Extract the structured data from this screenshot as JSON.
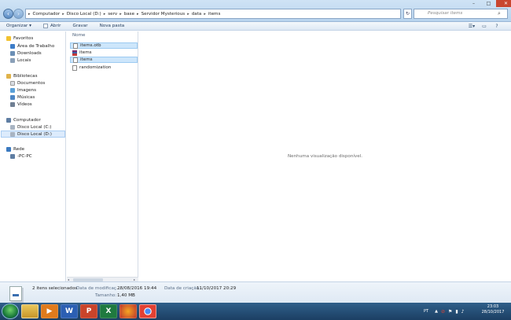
{
  "address": {
    "segments": [
      "Computador",
      "Disco Local (D:)",
      "serv",
      "base",
      "Servidor Mysterious",
      "data",
      "items"
    ]
  },
  "search": {
    "placeholder": "Pesquisar items"
  },
  "window_buttons": {
    "minimize": "–",
    "maximize": "□",
    "close": "✕"
  },
  "toolbar": {
    "organize": "Organizar",
    "open": "Abrir",
    "save": "Gravar",
    "new_folder": "Nova pasta"
  },
  "nav": {
    "favorites": "Favoritos",
    "desktop": "Área de Trabalho",
    "downloads": "Downloads",
    "places": "Locais",
    "libraries": "Bibliotecas",
    "documents": "Documentos",
    "images": "Imagens",
    "music": "Músicas",
    "videos": "Vídeos",
    "computer": "Computador",
    "disk_c": "Disco Local (C:)",
    "disk_d": "Disco Local (D:)",
    "network": "Rede",
    "pc": "-PC-PC"
  },
  "list": {
    "header": "Nome",
    "files": [
      {
        "name": "items.otb",
        "selected": true
      },
      {
        "name": "items",
        "selected": false
      },
      {
        "name": "items",
        "selected": true
      },
      {
        "name": "randomization",
        "selected": false
      }
    ]
  },
  "preview": {
    "message": "Nenhuma visualização disponível."
  },
  "details": {
    "count": "2 itens selecionados",
    "modified_label": "Data de modificaç...",
    "modified_value": "28/08/2016 19:44",
    "created_label": "Data de criação:",
    "created_value": "11/10/2017 20:29",
    "size_label": "Tamanho:",
    "size_value": "1,40 MB"
  },
  "tray": {
    "lang": "PT"
  },
  "clock": {
    "time": "23:03",
    "date": "28/10/2017"
  },
  "colors": {
    "accent": "#1e395b",
    "taskbar": "#1c3f63"
  }
}
